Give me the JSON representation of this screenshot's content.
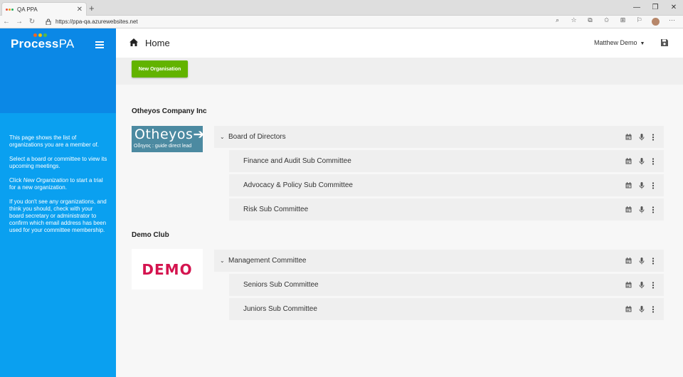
{
  "browser": {
    "tab_title": "QA PPA",
    "tab_close": "✕",
    "new_tab": "+",
    "url": "https://ppa-qa.azurewebsites.net",
    "window_controls": [
      "—",
      "❐",
      "✕"
    ],
    "favicon_colors": [
      "#e74c3c",
      "#f39c12",
      "#27ae60"
    ]
  },
  "sidebar": {
    "logo_main": "Process",
    "logo_accent": "PA",
    "logo_dot_colors": [
      "#f26522",
      "#f7c600",
      "#57b947"
    ],
    "help": {
      "p1": "This page shows the list of organizations you are a member of.",
      "p2": "Select a board or committee to view its upcoming meetings.",
      "p3_pre": "Click ",
      "p3_em": "New Organization",
      "p3_post": " to start a trial for a new organization.",
      "p4": "If you don't see any organizations, and think you should, check with your board secretary or administrator to confirm which email address has been used for your committee membership."
    },
    "bg_color": "#0aa0f0",
    "top_color": "#0b88e6"
  },
  "header": {
    "title": "Home",
    "user_name": "Matthew Demo",
    "caret": "▼"
  },
  "toolbar": {
    "new_org_label": "New Organisation",
    "button_color": "#62b300"
  },
  "orgs": [
    {
      "name": "Otheyos Company Inc",
      "logo_text": "Otheyos",
      "logo_arrow": "➔",
      "logo_tagline": "Οδηγος : guide direct lead",
      "parent": "Board of Directors",
      "children": [
        "Finance and Audit Sub Committee",
        "Advocacy & Policy Sub Committee",
        "Risk Sub Committee"
      ]
    },
    {
      "name": "Demo Club",
      "logo_text": "DEMO",
      "parent": "Management Committee",
      "children": [
        "Seniors Sub Committee",
        "Juniors Sub Committee"
      ]
    }
  ],
  "icons": {
    "chevron": "⌄"
  }
}
